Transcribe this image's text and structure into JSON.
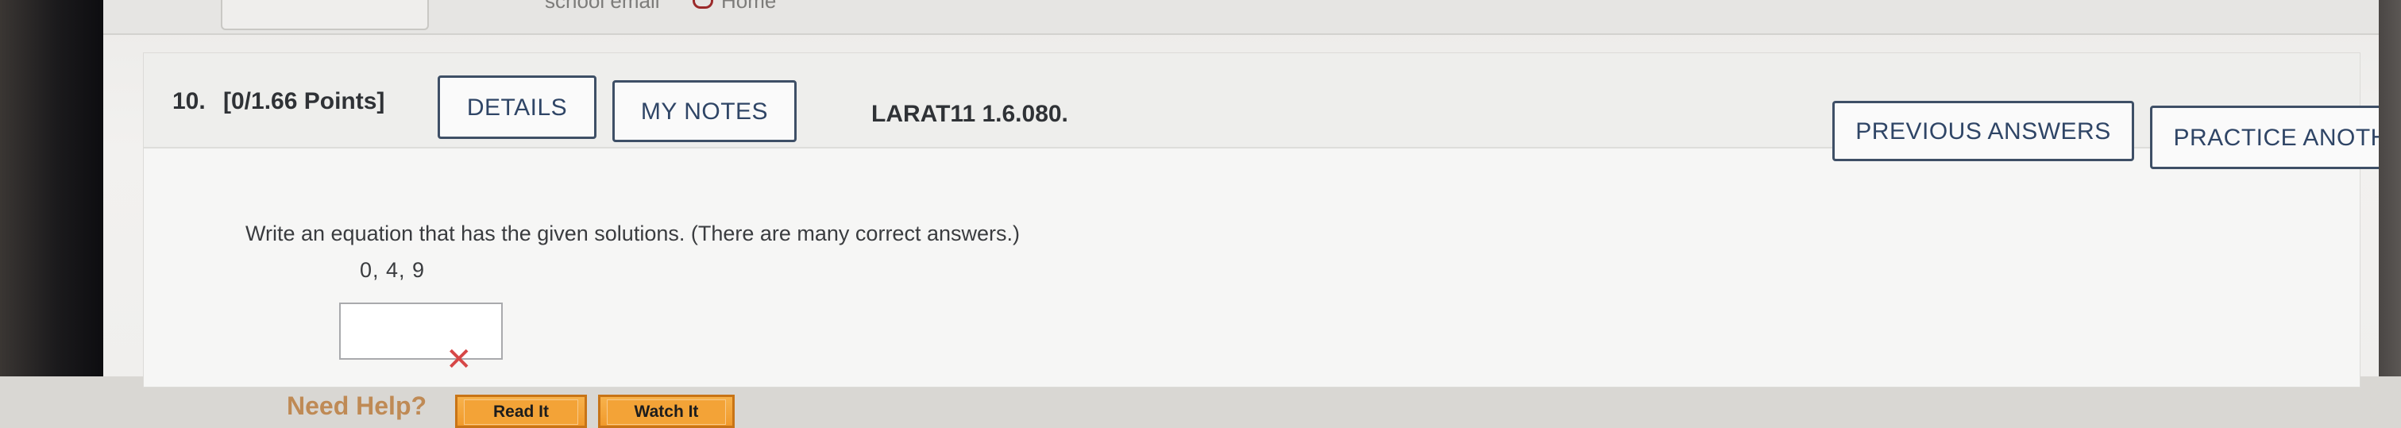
{
  "top_nav": {
    "school_email": "school email",
    "home": "Home"
  },
  "question": {
    "number": "10.",
    "points": "[0/1.66 Points]",
    "details_label": "DETAILS",
    "my_notes_label": "MY NOTES",
    "code": "LARAT11 1.6.080.",
    "previous_answers_label": "PREVIOUS ANSWERS",
    "practice_another_label": "PRACTICE ANOTHER",
    "instruction": "Write an equation that has the given solutions. (There are many correct answers.)",
    "solutions": "0, 4, 9",
    "answer_value": "",
    "status_icon": "x-mark-icon"
  },
  "help": {
    "label": "Need Help?",
    "read_it_label": "Read It",
    "watch_it_label": "Watch It"
  },
  "colors": {
    "button_border": "#3e4f66",
    "incorrect_mark": "#d64747",
    "help_label": "#bf8a55",
    "help_button": "#f19a2c"
  }
}
